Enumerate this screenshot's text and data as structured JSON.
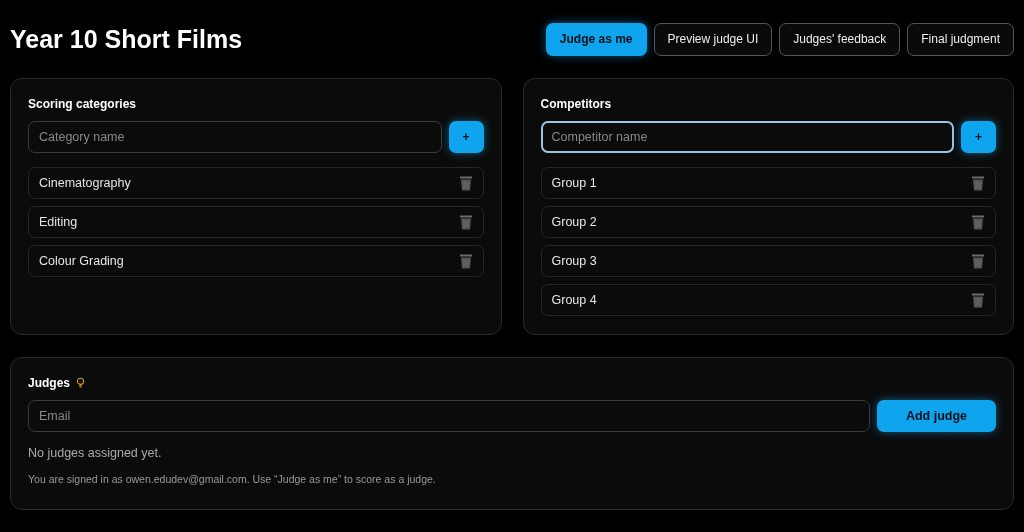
{
  "title": "Year 10 Short Films",
  "actions": [
    {
      "label": "Judge as me",
      "kind": "primary"
    },
    {
      "label": "Preview judge UI",
      "kind": "outline"
    },
    {
      "label": "Judges' feedback",
      "kind": "outline"
    },
    {
      "label": "Final judgment",
      "kind": "outline"
    }
  ],
  "panels": [
    {
      "heading": "Scoring categories",
      "field": {
        "placeholder": "Category name",
        "focused": false
      },
      "add_label": "+",
      "items": [
        "Cinematography",
        "Editing",
        "Colour Grading"
      ]
    },
    {
      "heading": "Competitors",
      "field": {
        "placeholder": "Competitor name",
        "focused": true
      },
      "add_label": "+",
      "items": [
        "Group 1",
        "Group 2",
        "Group 3",
        "Group 4"
      ]
    }
  ],
  "judges": {
    "heading": "Judges",
    "field": {
      "placeholder": "Email"
    },
    "button": "Add judge",
    "empty": "No judges assigned yet.",
    "note": "You are signed in as owen.edudev@gmail.com. Use “Judge as me” to score as a judge."
  }
}
